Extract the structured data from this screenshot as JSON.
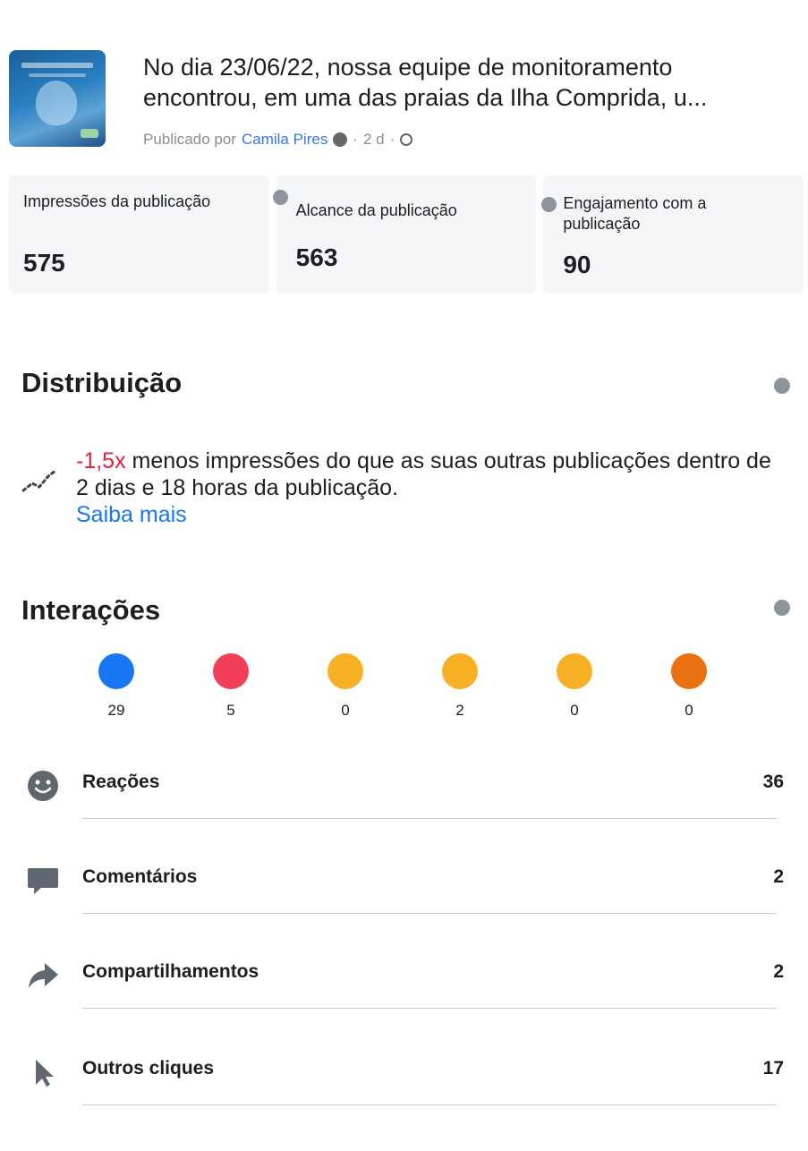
{
  "post": {
    "title": "No dia 23/06/22, nossa equipe de monitoramento encontrou, em uma das praias da Ilha Comprida, u...",
    "meta_prefix": "Publicado por",
    "author": "Camila Pires",
    "age": "2 d"
  },
  "metrics": [
    {
      "label": "Impressões da publicação",
      "value": "575"
    },
    {
      "label": "Alcance da publicação",
      "value": "563"
    },
    {
      "label": "Engajamento com a publicação",
      "value": "90"
    }
  ],
  "distribution": {
    "title": "Distribuição",
    "highlight": "-1,5x",
    "text": " menos impressões do que as suas outras publicações dentro de 2 dias e 18 horas da publicação.",
    "link": "Saiba mais",
    "highlight_color": "#e41e3f",
    "link_color": "#1877f2"
  },
  "interactions": {
    "title": "Interações",
    "reactions": [
      {
        "name": "like",
        "count": "29",
        "color": "#1877f2"
      },
      {
        "name": "love",
        "count": "5",
        "color": "#f33e58"
      },
      {
        "name": "haha",
        "count": "0",
        "color": "#f7b125"
      },
      {
        "name": "wow",
        "count": "2",
        "color": "#f7b125"
      },
      {
        "name": "sad",
        "count": "0",
        "color": "#f7b125"
      },
      {
        "name": "angry",
        "count": "0",
        "color": "#e9710f"
      }
    ],
    "rows": [
      {
        "label": "Reações",
        "value": "36",
        "icon": "smiley-icon"
      },
      {
        "label": "Comentários",
        "value": "2",
        "icon": "comment-icon"
      },
      {
        "label": "Compartilhamentos",
        "value": "2",
        "icon": "share-icon"
      },
      {
        "label": "Outros cliques",
        "value": "17",
        "icon": "cursor-icon"
      }
    ]
  }
}
